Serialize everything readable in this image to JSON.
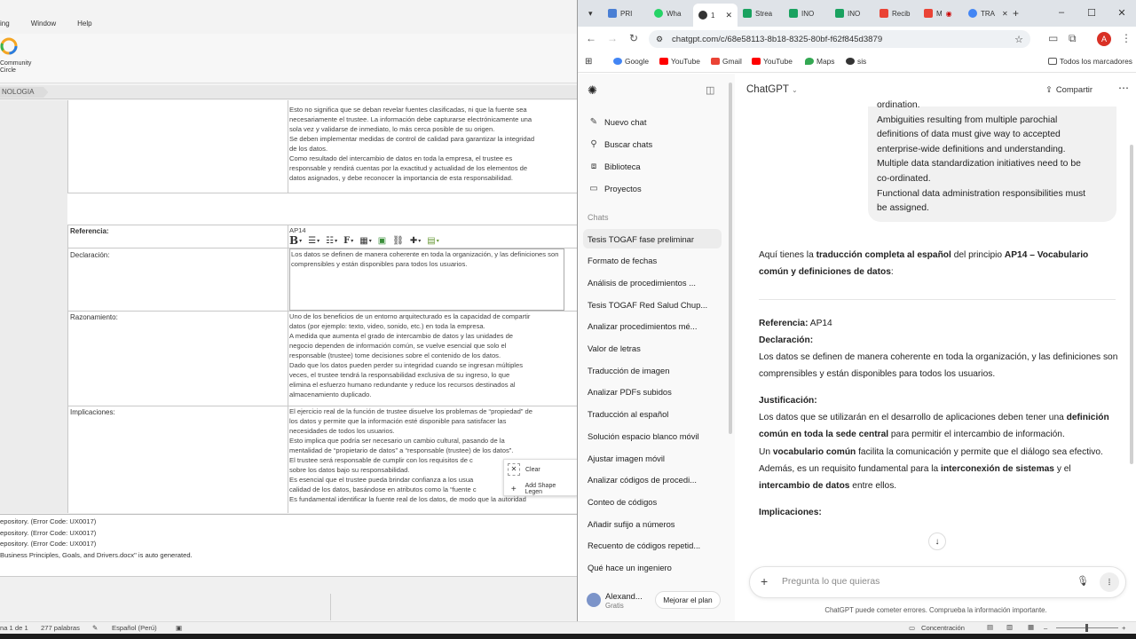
{
  "left_app": {
    "menu": [
      "ing",
      "Window",
      "Help"
    ],
    "community_circle": "Community\nCircle",
    "tab_label": "NOLOGIA",
    "table_rows": {
      "top_lines": [
        "Esto no significa que se deban revelar fuentes clasificadas, ni que la fuente sea",
        "necesariamente el trustee. La información debe capturarse electrónicamente una",
        "sola vez y validarse de inmediato, lo más cerca posible de su origen.",
        "Se deben implementar medidas de control de calidad para garantizar la integridad",
        "de los datos.",
        "Como resultado del intercambio de datos en toda la empresa, el trustee es",
        "responsable y rendirá cuentas por la exactitud y actualidad de los elementos de",
        "datos asignados, y debe reconocer la importancia de esta responsabilidad."
      ],
      "referencia_label": "Referencia:",
      "referencia_value": "AP14",
      "declaracion_label": "Declaración:",
      "declaracion_text": "Los datos se definen de manera coherente en toda la organización, y las definiciones son comprensibles y están disponibles para todos los usuarios.",
      "razonamiento_label": "Razonamiento:",
      "razonamiento_lines": [
        "Uno de los beneficios de un entorno arquitecturado es la capacidad de compartir",
        "datos (por ejemplo: texto, video, sonido, etc.) en toda la empresa.",
        "A medida que aumenta el grado de intercambio de datos y las unidades de",
        "negocio dependen de información común, se vuelve esencial que solo el",
        "responsable (trustee) tome decisiones sobre el contenido de los datos.",
        "Dado que los datos pueden perder su integridad cuando se ingresan múltiples",
        "veces, el trustee tendrá la responsabilidad exclusiva de su ingreso, lo que",
        "elimina el esfuerzo humano redundante y reduce los recursos destinados al",
        "almacenamiento duplicado."
      ],
      "implicaciones_label": "Implicaciones:",
      "implicaciones_lines": [
        "El ejercicio real de la función de trustee disuelve los problemas de “propiedad” de",
        "los datos y permite que la información esté disponible para satisfacer las",
        "necesidades de todos los usuarios.",
        "Esto implica que podría ser necesario un cambio cultural, pasando de la",
        "mentalidad de “propietario de datos” a “responsable (trustee) de los datos”.",
        "El trustee será responsable de cumplir con los requisitos de c",
        "sobre los datos bajo su responsabilidad.",
        "Es esencial que el trustee pueda brindar confianza a los usua",
        "calidad de los datos, basándose en atributos como la “fuente c",
        "Es fundamental identificar la fuente real de los datos, de modo que la autoridad"
      ]
    },
    "context_menu": {
      "clear": "Clear",
      "add_shape_legend": "Add Shape Legen"
    },
    "log_lines": [
      "epository.  (Error Code: UX0017)",
      "epository.  (Error Code: UX0017)",
      "epository.  (Error Code: UX0017)",
      "Business Principles, Goals, and Drivers.docx\" is auto generated."
    ],
    "status": {
      "page": "na 1 de 1",
      "words": "277 palabras",
      "language": "Español (Perú)"
    }
  },
  "chrome": {
    "tabs": [
      "PRI",
      "Wha",
      "1",
      "Strea",
      "INO",
      "INO",
      "Recib",
      "M",
      "TRA"
    ],
    "url": "chatgpt.com/c/68e58113-8b18-8325-80bf-f62f845d3879",
    "profile_initial": "A",
    "bookmarks": [
      "Google",
      "YouTube",
      "Gmail",
      "YouTube",
      "Maps",
      "sis"
    ],
    "all_bookmarks": "Todos los marcadores"
  },
  "gpt": {
    "sidebar": {
      "nav": [
        "Nuevo chat",
        "Buscar chats",
        "Biblioteca",
        "Proyectos"
      ],
      "chats_heading": "Chats",
      "chats": [
        "Tesis TOGAF fase preliminar",
        "Formato de fechas",
        "Análisis de procedimientos ...",
        "Tesis TOGAF Red Salud Chup...",
        "Analizar procedimientos mé...",
        "Valor de letras",
        "Traducción de imagen",
        "Analizar PDFs subidos",
        "Traducción al español",
        "Solución espacio blanco móvil",
        "Ajustar imagen móvil",
        "Analizar códigos de procedi...",
        "Conteo de códigos",
        "Añadir sufijo a números",
        "Recuento de códigos repetid...",
        "Qué hace un ingeniero"
      ],
      "user_name": "Alexand...",
      "user_plan": "Gratis",
      "upgrade": "Mejorar el plan"
    },
    "header": {
      "model": "ChatGPT",
      "share": "Compartir"
    },
    "user_message_lines": [
      "Ambiguities resulting from multiple parochial",
      "definitions of data must give way to accepted",
      "enterprise-wide definitions and understanding.",
      "Multiple data standardization initiatives need to be",
      "co-ordinated.",
      "Functional data administration responsibilities must",
      "be assigned."
    ],
    "user_message_top": "ordination.",
    "answer": {
      "intro_a": "Aquí tienes la ",
      "intro_b": "traducción completa al español",
      "intro_c": " del principio ",
      "intro_d": "AP14 – Vocabulario común y definiciones de datos",
      "intro_e": ":",
      "ref_label": "Referencia:",
      "ref_value": " AP14",
      "decl_label": "Declaración:",
      "decl_text": "Los datos se definen de manera coherente en toda la organización, y las definiciones son comprensibles y están disponibles para todos los usuarios.",
      "just_label": "Justificación:",
      "just_1a": "Los datos que se utilizarán en el desarrollo de aplicaciones deben tener una ",
      "just_1b": "definición común en toda la sede central",
      "just_1c": " para permitir el intercambio de información.",
      "just_2a": "Un ",
      "just_2b": "vocabulario común",
      "just_2c": " facilita la comunicación y permite que el diálogo sea efectivo.",
      "just_3a": "Además, es un requisito fundamental para la ",
      "just_3b": "interconexión de sistemas",
      "just_3c": " y el ",
      "just_3d": "intercambio de datos",
      "just_3e": " entre ellos.",
      "impl_label": "Implicaciones:"
    },
    "composer_placeholder": "Pregunta lo que quieras",
    "disclaimer": "ChatGPT puede cometer errores. Comprueba la información importante."
  },
  "status_right": {
    "focus": "Concentración"
  }
}
